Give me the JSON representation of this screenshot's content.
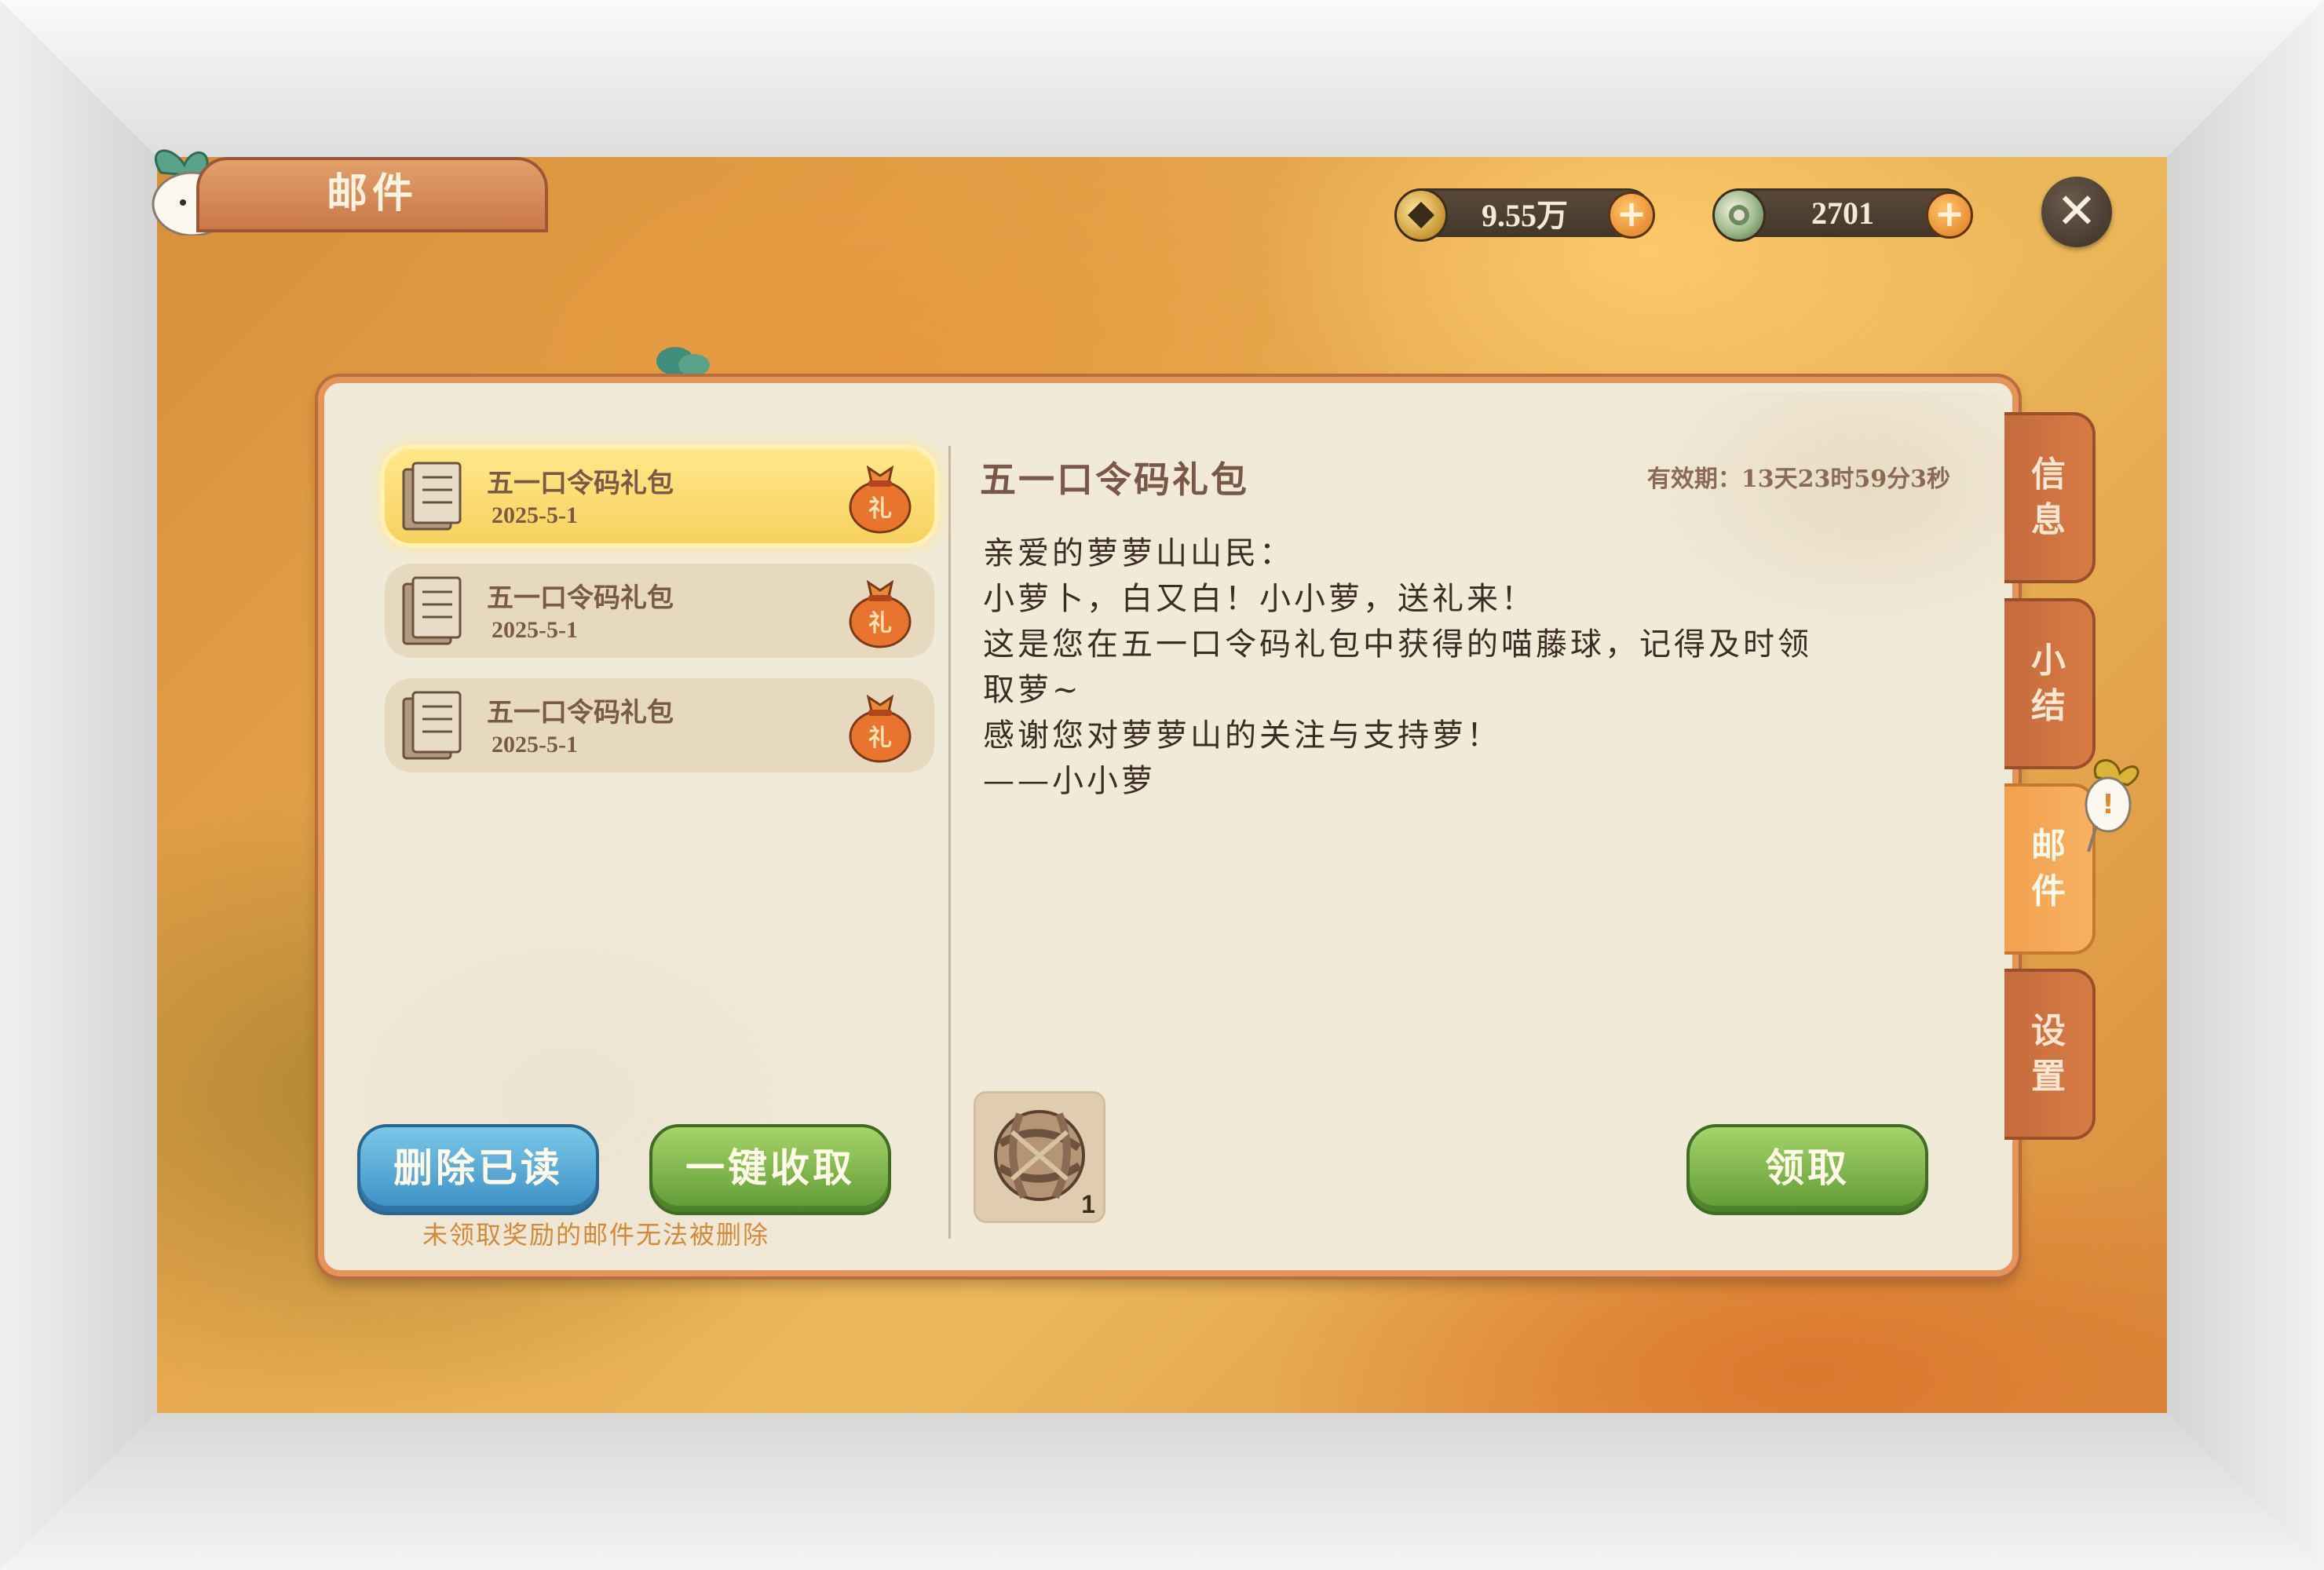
{
  "header": {
    "currencies": [
      {
        "icon": "copper-coin-icon",
        "value": "9.55万"
      },
      {
        "icon": "jade-coin-icon",
        "value": "2701"
      }
    ],
    "plus_symbol": "+",
    "close_symbol": "✕"
  },
  "panel": {
    "title": "邮件"
  },
  "mail_list": [
    {
      "title": "五一口令码礼包",
      "date": "2025-5-1",
      "selected": true
    },
    {
      "title": "五一口令码礼包",
      "date": "2025-5-1",
      "selected": false
    },
    {
      "title": "五一口令码礼包",
      "date": "2025-5-1",
      "selected": false
    }
  ],
  "list_actions": {
    "delete_read_label": "删除已读",
    "collect_all_label": "一键收取",
    "hint": "未领取奖励的邮件无法被删除"
  },
  "detail": {
    "title": "五一口令码礼包",
    "validity": "有效期：13天23时59分3秒",
    "body": [
      "亲爱的萝萝山山民：",
      "小萝卜，白又白！小小萝，送礼来！",
      "这是您在五一口令码礼包中获得的喵藤球，记得及时领",
      "取萝~",
      "感谢您对萝萝山的关注与支持萝！",
      "——小小萝"
    ],
    "reward": {
      "icon": "rattan-ball-icon",
      "count": "1"
    },
    "claim_label": "领取"
  },
  "side_tabs": [
    {
      "label": [
        "信",
        "息"
      ],
      "active": false
    },
    {
      "label": [
        "小",
        "结"
      ],
      "active": false
    },
    {
      "label": [
        "邮",
        "件"
      ],
      "active": true
    },
    {
      "label": [
        "设",
        "置"
      ],
      "active": false
    }
  ],
  "colors": {
    "panel_bg": "#f2ead9",
    "panel_border": "#e4955a",
    "selected_item": "#f7d160",
    "blue_button": "#3a8fc4",
    "green_button": "#5f9a35",
    "hint_text": "#d18a3a"
  }
}
